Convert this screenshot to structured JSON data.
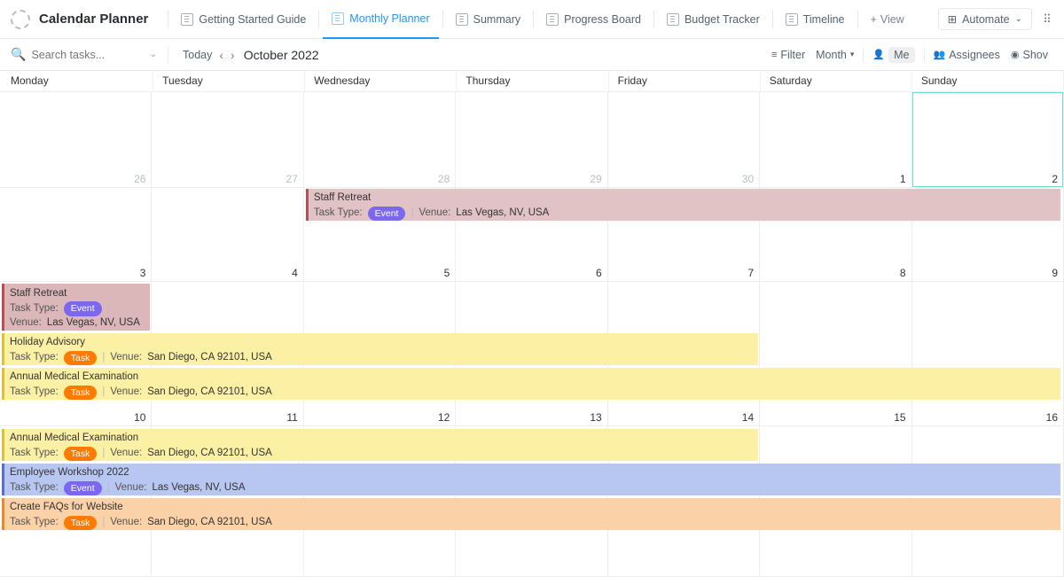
{
  "header": {
    "page_title": "Calendar Planner",
    "tabs": [
      "Getting Started Guide",
      "Monthly Planner",
      "Summary",
      "Progress Board",
      "Budget Tracker",
      "Timeline"
    ],
    "active_tab": "Monthly Planner",
    "add_view": "View",
    "automate": "Automate"
  },
  "toolbar": {
    "search_placeholder": "Search tasks...",
    "today": "Today",
    "month_label": "October 2022",
    "filter": "Filter",
    "period": "Month",
    "me": "Me",
    "assignees": "Assignees",
    "show": "Shov"
  },
  "days": [
    "Monday",
    "Tuesday",
    "Wednesday",
    "Thursday",
    "Friday",
    "Saturday",
    "Sunday"
  ],
  "weeks": [
    {
      "dates": [
        "26",
        "27",
        "28",
        "29",
        "30",
        "1",
        "2"
      ],
      "dim": [
        true,
        true,
        true,
        true,
        true,
        false,
        false
      ],
      "today_index": 6
    },
    {
      "dates": [
        "3",
        "4",
        "5",
        "6",
        "7",
        "8",
        "9"
      ]
    },
    {
      "dates": [
        "10",
        "11",
        "12",
        "13",
        "14",
        "15",
        "16"
      ]
    }
  ],
  "labels": {
    "task_type": "Task Type:",
    "venue": "Venue:",
    "event_pill": "Event",
    "task_pill": "Task"
  },
  "events": {
    "staff_retreat": {
      "title": "Staff Retreat",
      "venue": "Las Vegas, NV, USA"
    },
    "holiday_advisory": {
      "title": "Holiday Advisory",
      "venue": "San Diego, CA 92101, USA"
    },
    "annual_medical": {
      "title": "Annual Medical Examination",
      "venue": "San Diego, CA 92101, USA"
    },
    "employee_workshop": {
      "title": "Employee Workshop 2022",
      "venue": "Las Vegas, NV, USA"
    },
    "faqs": {
      "title": "Create FAQs for Website",
      "venue": "San Diego, CA 92101, USA"
    }
  }
}
